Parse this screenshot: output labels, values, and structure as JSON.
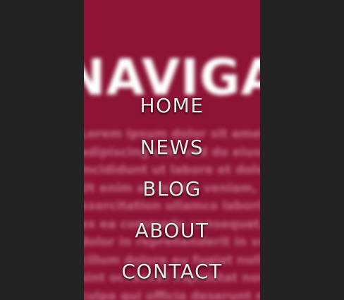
{
  "background": {
    "heading": "NAVIGATION",
    "paragraph_lines": [
      "Lorem ipsum dolor sit amet, consectetur",
      "adipiscing elit, sed do eiusmod tempor",
      "incididunt ut labore et dolore magna aliqua.",
      "Ut enim ad minim veniam, quis nostrud",
      "exercitation ullamco laboris nisi ut aliquip",
      "ex ea commodo consequat. Duis aute irure",
      "dolor in reprehenderit in voluptate velit esse",
      "cillum dolore eu fugiat nulla pariatur. Excepteur",
      "sint occaecat cupidatat non proident, sunt in",
      "culpa qui officia deserunt mollit anim id est"
    ]
  },
  "nav": {
    "items": [
      {
        "label": "HOME"
      },
      {
        "label": "NEWS"
      },
      {
        "label": "BLOG"
      },
      {
        "label": "ABOUT"
      },
      {
        "label": "CONTACT"
      }
    ]
  },
  "colors": {
    "page_background": "#232323",
    "panel_background": "#8e1436",
    "nav_text": "#eae6e6"
  }
}
